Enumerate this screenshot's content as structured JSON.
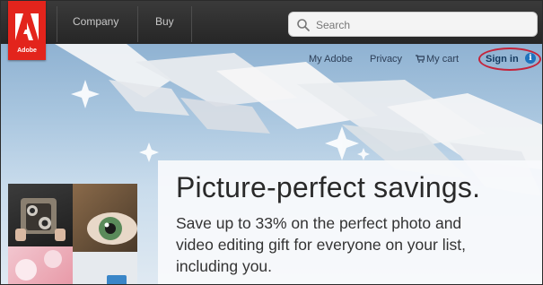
{
  "brand": {
    "logo_text": "Adobe",
    "logo_color": "#e3241c"
  },
  "nav": {
    "items": [
      {
        "label": "Company"
      },
      {
        "label": "Buy"
      }
    ],
    "search": {
      "placeholder": "Search",
      "icon": "search-icon"
    }
  },
  "utility_links": {
    "my_adobe": "My Adobe",
    "privacy": "Privacy",
    "my_cart": "My cart",
    "cart_icon": "cart-icon",
    "sign_in": "Sign in",
    "info_icon": "info-icon",
    "sign_in_highlight_color": "#c4243b"
  },
  "promo": {
    "headline": "Picture-perfect savings.",
    "body_lines": [
      "Save up to 33% on the perfect photo and",
      "video editing gift for everyone on your list,",
      "including you."
    ]
  },
  "colors": {
    "nav_bg": "#2e2e2e",
    "link": "#2c3e57",
    "accent_blue": "#1e73be"
  }
}
